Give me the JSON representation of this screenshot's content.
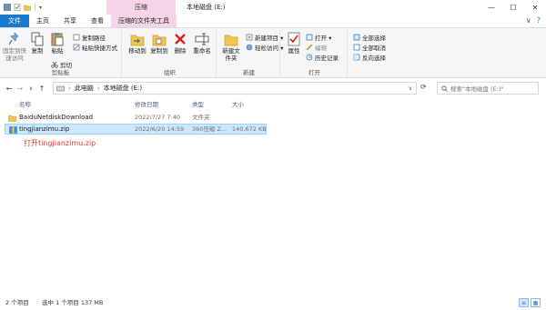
{
  "window": {
    "context_tab_group": "压缩",
    "title": "本地磁盘 (E:)",
    "minimize": "—",
    "maximize": "☐",
    "close": "✕"
  },
  "ribbon_tabs": {
    "file": "文件",
    "home": "主页",
    "share": "共享",
    "view": "查看",
    "compressed_tools": "压缩的文件夹工具",
    "help": "?"
  },
  "ribbon": {
    "clipboard": {
      "label": "剪贴板",
      "pin": "固定到快速访问",
      "copy": "复制",
      "paste": "粘贴",
      "copy_path": "复制路径",
      "paste_shortcut": "粘贴快捷方式",
      "cut": "剪切"
    },
    "organize": {
      "label": "组织",
      "move_to": "移动到",
      "copy_to": "复制到",
      "delete": "删除",
      "rename": "重命名"
    },
    "new": {
      "label": "新建",
      "new_folder": "新建文件夹",
      "new_item": "新建项目 ▾",
      "easy_access": "轻松访问 ▾"
    },
    "open": {
      "label": "打开",
      "properties": "属性",
      "open": "打开 ▾",
      "edit": "编辑",
      "history": "历史记录"
    },
    "select": {
      "select_all": "全部选择",
      "select_none": "全部取消",
      "invert": "反向选择"
    }
  },
  "nav": {
    "back": "←",
    "forward": "→",
    "recent": "∨",
    "up": "↑",
    "breadcrumb_pc": "此电脑",
    "breadcrumb_sep": "›",
    "breadcrumb_drive": "本地磁盘 (E:)",
    "search_placeholder": "搜索\"本地磁盘 (E:)\""
  },
  "columns": {
    "name": "名称",
    "date": "修改日期",
    "type": "类型",
    "size": "大小"
  },
  "files": [
    {
      "name": "BaiduNetdiskDownload",
      "date": "2022/7/27 7:40",
      "type": "文件夹",
      "size": "",
      "icon": "folder-icon"
    },
    {
      "name": "tingjianzimu.zip",
      "date": "2022/6/20 14:59",
      "type": "360压缩 Z...",
      "size": "140,672 KB",
      "icon": "zip-icon"
    }
  ],
  "hint_text": "打开tingjianzimu.zip",
  "status": {
    "count": "2 个项目",
    "selected": "选中 1 个项目  137 MB"
  },
  "colors": {
    "file_tab": "#1979ca",
    "context_tab": "#f6d3e6",
    "selection": "#cce8ff",
    "hint": "#e8332d"
  }
}
